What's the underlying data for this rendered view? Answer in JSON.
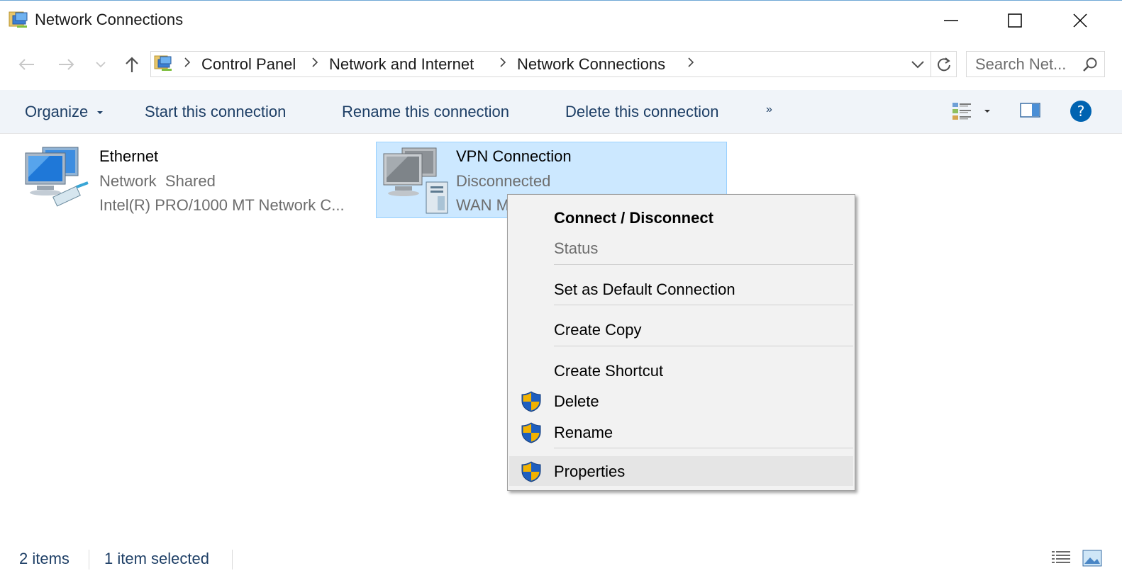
{
  "window": {
    "title": "Network Connections",
    "minimize_icon": "minimize-icon",
    "maximize_icon": "maximize-icon",
    "close_icon": "close-icon"
  },
  "address": {
    "crumbs": [
      "Control Panel",
      "Network and Internet",
      "Network Connections"
    ],
    "search_placeholder": "Search Net..."
  },
  "toolbar": {
    "organize": "Organize",
    "start": "Start this connection",
    "rename": "Rename this connection",
    "delete": "Delete this connection",
    "more": "»"
  },
  "items": [
    {
      "name": "Ethernet",
      "status": "Network  Shared",
      "device": "Intel(R) PRO/1000 MT Network C..."
    },
    {
      "name": "VPN Connection",
      "status": "Disconnected",
      "device": "WAN M"
    }
  ],
  "context_menu": {
    "items": [
      {
        "label": "Connect / Disconnect",
        "bold": true
      },
      {
        "label": "Status",
        "disabled": true
      },
      {
        "label": "Set as Default Connection"
      },
      {
        "label": "Create Copy"
      },
      {
        "label": "Create Shortcut"
      },
      {
        "label": "Delete",
        "icon": "uac-shield-icon"
      },
      {
        "label": "Rename",
        "icon": "uac-shield-icon"
      },
      {
        "label": "Properties",
        "icon": "uac-shield-icon",
        "highlighted": true
      }
    ]
  },
  "status_bar": {
    "count": "2 items",
    "selected": "1 item selected"
  },
  "colors": {
    "accent": "#0063b1",
    "selection_bg": "#cce8ff",
    "toolbar_bg": "#f0f4f9",
    "toolbar_text": "#1e3f66",
    "shield_blue": "#1f5fbf",
    "shield_gold": "#f2b200"
  }
}
